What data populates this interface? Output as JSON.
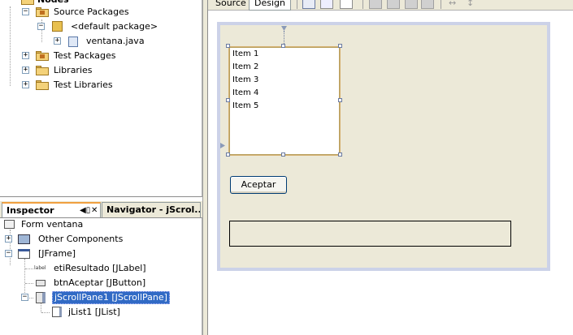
{
  "project_tree": {
    "nodes": [
      {
        "label": "Nodes"
      },
      {
        "label": "Source Packages"
      },
      {
        "label": "<default package>"
      },
      {
        "label": "ventana.java"
      },
      {
        "label": "Test Packages"
      },
      {
        "label": "Libraries"
      },
      {
        "label": "Test Libraries"
      }
    ]
  },
  "inspector": {
    "tabs": [
      {
        "label": "Inspector",
        "active": true
      },
      {
        "label": "Navigator - jScrol...",
        "active": false
      }
    ],
    "pin_icon": "pin-icon",
    "close_glyph": "✕",
    "nodes": [
      {
        "label": "Form ventana",
        "icon": "form-icon"
      },
      {
        "label": "Other Components",
        "icon": "components-icon"
      },
      {
        "label": "[JFrame]",
        "icon": "jframe-icon"
      },
      {
        "label": "etiResultado [JLabel]",
        "icon": "jlabel-icon",
        "icon_text": "label"
      },
      {
        "label": "btnAceptar [JButton]",
        "icon": "jbutton-icon"
      },
      {
        "label": "jScrollPane1 [JScrollPane]",
        "icon": "jscrollpane-icon",
        "selected": true
      },
      {
        "label": "jList1 [JList]",
        "icon": "jlist-icon"
      }
    ]
  },
  "editor": {
    "tabs": {
      "source": "Source",
      "design": "Design"
    },
    "list_items": [
      "Item 1",
      "Item 2",
      "Item 3",
      "Item 4",
      "Item 5"
    ],
    "button_label": "Aceptar",
    "colors": {
      "selection": "#316ac5",
      "design_bg": "#ece9d8",
      "design_border": "#ccd2e8",
      "selection_border": "#d4b070"
    }
  }
}
